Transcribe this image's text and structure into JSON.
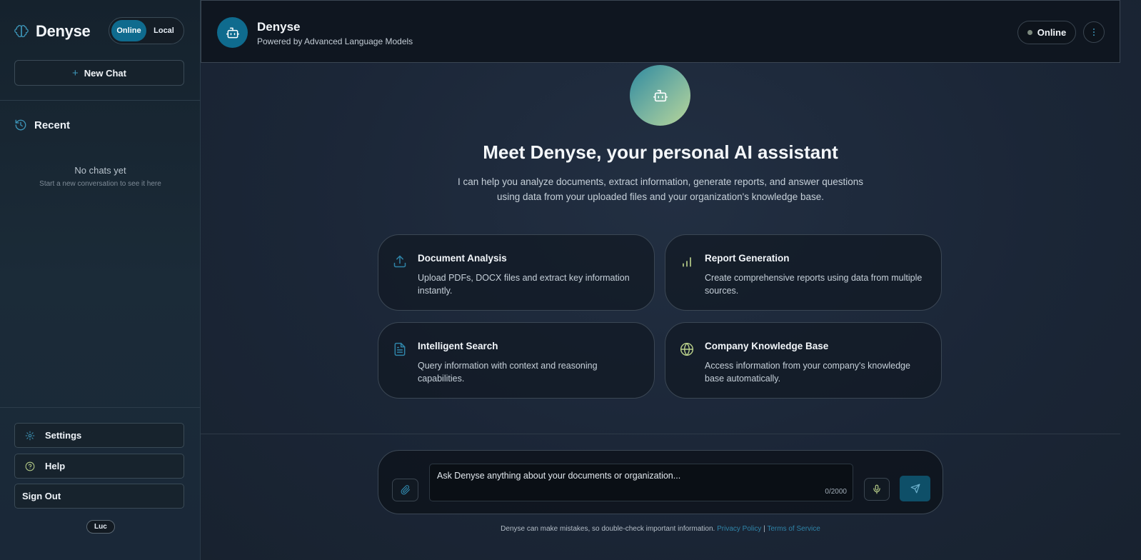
{
  "sidebar": {
    "brand": "Denyse",
    "mode_toggle": {
      "online": "Online",
      "local": "Local",
      "selected": "Online"
    },
    "new_chat": "New Chat",
    "recent_title": "Recent",
    "empty_title": "No chats yet",
    "empty_subtitle": "Start a new conversation to see it here",
    "settings": "Settings",
    "help": "Help",
    "sign_out": "Sign Out",
    "user": "Luc"
  },
  "header": {
    "title": "Denyse",
    "subtitle": "Powered by Advanced Language Models",
    "status": "Online"
  },
  "hero": {
    "title": "Meet Denyse, your personal AI assistant",
    "description": "I can help you analyze documents, extract information, generate reports, and answer questions using data from your uploaded files and your organization's knowledge base."
  },
  "cards": [
    {
      "icon": "upload-icon",
      "title": "Document Analysis",
      "description": "Upload PDFs, DOCX files and extract key information instantly."
    },
    {
      "icon": "bar-chart-icon",
      "title": "Report Generation",
      "description": "Create comprehensive reports using data from multiple sources."
    },
    {
      "icon": "document-icon",
      "title": "Intelligent Search",
      "description": "Query information with context and reasoning capabilities."
    },
    {
      "icon": "globe-icon",
      "title": "Company Knowledge Base",
      "description": "Access information from your company's knowledge base automatically."
    }
  ],
  "composer": {
    "placeholder": "Ask Denyse anything about your documents or organization...",
    "char_count": "0/2000"
  },
  "footer": {
    "note": "Denyse can make mistakes, so double-check important information.",
    "privacy": "Privacy Policy",
    "separator": "|",
    "terms": "Terms of Service"
  },
  "colors": {
    "accent": "#0f6b8e",
    "link": "#2f84a8",
    "background": "#1a2433"
  }
}
